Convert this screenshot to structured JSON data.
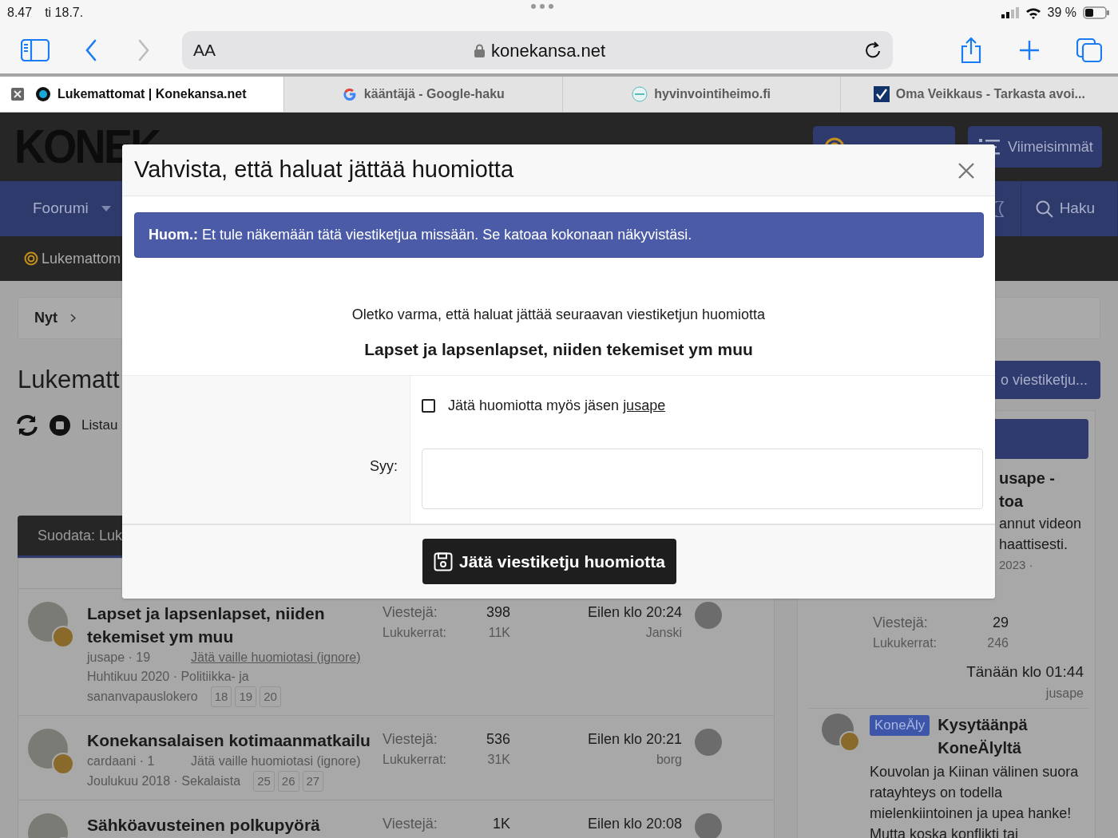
{
  "status_bar": {
    "time": "8.47",
    "date": "ti 18.7.",
    "battery": "39 %"
  },
  "browser": {
    "text_size": "AA",
    "address": "konekansa.net",
    "tabs": [
      {
        "title": "Lukemattomat | Konekansa.net",
        "kind": "gear",
        "selected": true
      },
      {
        "title": "kääntäjä - Google-haku",
        "kind": "google",
        "selected": false
      },
      {
        "title": "hyvinvointiheimo.fi",
        "kind": "circle",
        "selected": false
      },
      {
        "title": "Oma Veikkaus - Tarkasta avoi...",
        "kind": "check",
        "selected": false
      }
    ]
  },
  "site_header": {
    "logo": "KONEK",
    "buttons": [
      {
        "kind": "unread"
      },
      {
        "kind": "latest",
        "label": "Viimeisimmät"
      }
    ]
  },
  "nav": {
    "items": [
      {
        "kind": "dropdown",
        "label": "Foorumi"
      },
      {
        "kind": "theme"
      },
      {
        "kind": "search",
        "label": "Haku"
      }
    ]
  },
  "sub_nav": {
    "label": "Lukemattom"
  },
  "page": {
    "breadcrumb": "Nyt",
    "title": "Lukematt",
    "action_button": "o viestiketju...",
    "actions_label": "Listau",
    "filter": "Suodata: Luk"
  },
  "threads": [
    {
      "title": "Lapset ja lapsenlapset, niiden tekemiset ym muu",
      "author": "jusape · 19",
      "ignore_link": "Jätä vaille huomiotasi (ignore)",
      "hovered": true,
      "date": "Huhtikuu 2020 · Politiikka- ja",
      "forum": "sananvapauslokero",
      "pages": [
        "18",
        "19",
        "20"
      ],
      "posts_label": "Viestejä:",
      "posts": "398",
      "views_label": "Lukukerrat:",
      "views": "11K",
      "last_time": "Eilen klo 20:24",
      "last_user": "Janski"
    },
    {
      "title": "Konekansalaisen kotimaanmatkailu",
      "author": "cardaani · 1",
      "ignore_link": "Jätä vaille huomiotasi (ignore)",
      "hovered": false,
      "date": "Joulukuu 2018 · Sekalaista",
      "pages": [
        "25",
        "26",
        "27"
      ],
      "posts_label": "Viestejä:",
      "posts": "536",
      "views_label": "Lukukerrat:",
      "views": "31K",
      "last_time": "Eilen klo 20:21",
      "last_user": "borg"
    },
    {
      "title": "Sähköavusteinen polkupyörä",
      "posts_label": "Viestejä:",
      "posts": "1K",
      "last_time": "Eilen klo 20:08"
    }
  ],
  "sidebar": {
    "fragments": [
      {
        "kind": "title",
        "text": "usape -"
      },
      {
        "kind": "title",
        "text": "toa"
      },
      {
        "kind": "text",
        "text": "annut videon"
      },
      {
        "kind": "text",
        "text": "haattisesti."
      },
      {
        "kind": "meta",
        "text": "2023 ·"
      }
    ],
    "posts_label": "Viestejä:",
    "posts": "29",
    "views_label": "Lukukerrat:",
    "views": "246",
    "last_time": "Tänään klo 01:44",
    "last_user": "jusape",
    "item": {
      "badge": "KoneÄly",
      "title": "Kysytäänpä KoneÄlyltä",
      "snippet": "Kouvolan ja Kiinan välinen suora ratayhteys on todella mielenkiintoinen ja upea hanke! Mutta koska konflikti tai"
    }
  },
  "modal": {
    "title": "Vahvista, että haluat jättää huomiotta",
    "notice": "**Huom.:** Et tule näkemään tätä viestiketjua missään. Se katoaa kokonaan näkyvistäsi.",
    "question": "Oletko varma, että haluat jättää seuraavan viestiketjun huomiotta",
    "thread_title": "Lapset ja lapsenlapset, niiden tekemiset ym muu",
    "checkbox_label": "Jätä huomiotta myös jäsen",
    "checkbox_link": "jusape",
    "checked": false,
    "reason_label": "Syy:",
    "submit": "Jätä viestiketju huomiotta"
  }
}
